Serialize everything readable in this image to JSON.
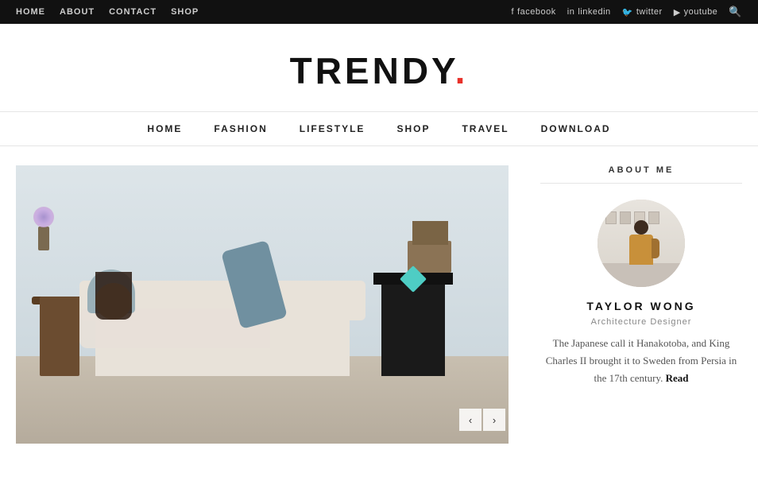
{
  "topbar": {
    "nav_links": [
      {
        "label": "HOME",
        "href": "#"
      },
      {
        "label": "ABOUT",
        "href": "#"
      },
      {
        "label": "CONTACT",
        "href": "#"
      },
      {
        "label": "SHOP",
        "href": "#"
      }
    ],
    "social_links": [
      {
        "icon": "f",
        "label": "facebook",
        "href": "#"
      },
      {
        "icon": "in",
        "label": "linkedin",
        "href": "#"
      },
      {
        "icon": "🐦",
        "label": "twitter",
        "href": "#"
      },
      {
        "icon": "▶",
        "label": "youtube",
        "href": "#"
      }
    ],
    "search_label": "🔍"
  },
  "logo": {
    "text": "TRENDY",
    "dot": "."
  },
  "main_nav": {
    "items": [
      {
        "label": "HOME",
        "href": "#"
      },
      {
        "label": "FASHION",
        "href": "#"
      },
      {
        "label": "LIFESTYLE",
        "href": "#"
      },
      {
        "label": "SHOP",
        "href": "#"
      },
      {
        "label": "TRAVEL",
        "href": "#"
      },
      {
        "label": "DOWNLOAD",
        "href": "#"
      }
    ]
  },
  "slider": {
    "prev_label": "‹",
    "next_label": "›"
  },
  "sidebar": {
    "about_title": "ABOUT ME",
    "name": "TAYLOR WONG",
    "role": "Architecture Designer",
    "bio": "The Japanese call it Hanakotoba, and King Charles II brought it to Sweden from Persia in the 17th century.",
    "read_label": "Read"
  }
}
